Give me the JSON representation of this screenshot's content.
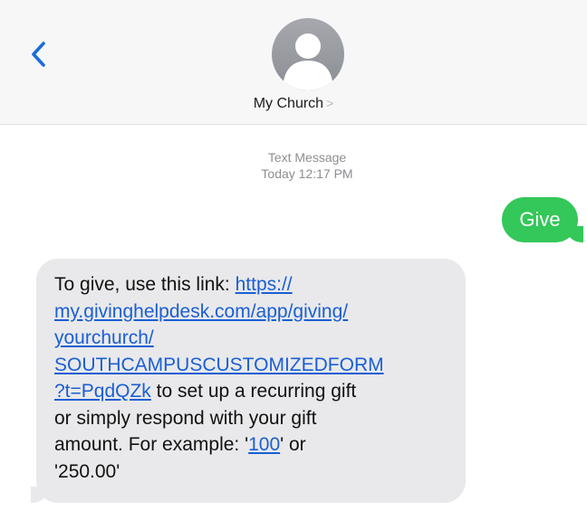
{
  "header": {
    "back_icon": "chevron-left-icon",
    "avatar_icon": "person-silhouette-icon",
    "contact_name": "My Church",
    "contact_chevron": ">",
    "accent_color": "#1a6ddb"
  },
  "thread": {
    "meta_type": "Text Message",
    "meta_time": "Today 12:17 PM"
  },
  "messages": {
    "outgoing": {
      "text": "Give",
      "color": "#34c759"
    },
    "incoming": {
      "text_before": "To give, use this link: ",
      "link_lines": [
        "https://",
        "my.givinghelpdesk.com/app/giving/",
        "yourchurch/",
        "SOUTHCAMPUSCUSTOMIZEDFORM",
        "?t=PqdQZk"
      ],
      "text_mid_1": " to set up a recurring gift",
      "text_mid_2": "or simply respond with your gift",
      "text_mid_3": "amount. For example: '",
      "example_link": "100",
      "text_mid_4": "' or",
      "text_end": "'250.00'",
      "color": "#e9e9eb"
    }
  }
}
